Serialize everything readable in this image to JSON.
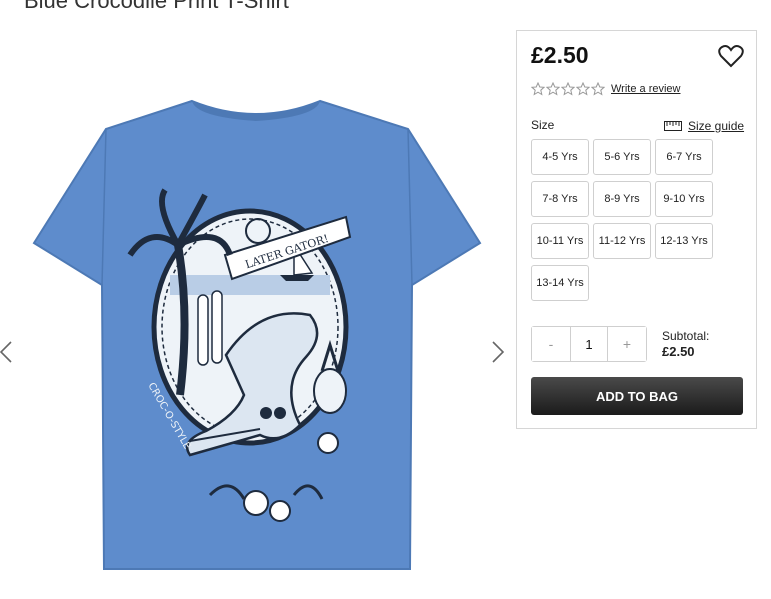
{
  "product": {
    "title": "Blue Crocodile Print T-Shirt",
    "price": "£2.50",
    "review_link": "Write a review",
    "rating_stars": 0,
    "rating_max": 5
  },
  "tshirt": {
    "print_banner": "LATER GATOR!",
    "print_side_text": "CROC-O-STYLE",
    "shirt_color": "#5e8ccc"
  },
  "size": {
    "label": "Size",
    "guide_label": "Size guide",
    "options": [
      "4-5 Yrs",
      "5-6 Yrs",
      "6-7 Yrs",
      "7-8 Yrs",
      "8-9 Yrs",
      "9-10 Yrs",
      "10-11 Yrs",
      "11-12 Yrs",
      "12-13 Yrs",
      "13-14 Yrs"
    ]
  },
  "quantity": {
    "minus": "-",
    "value": "1",
    "plus": "+"
  },
  "subtotal": {
    "label": "Subtotal:",
    "value": "£2.50"
  },
  "actions": {
    "add_to_bag": "ADD TO BAG"
  },
  "icons": {
    "prev": "chevron-left-icon",
    "next": "chevron-right-icon",
    "wishlist": "heart-icon",
    "size_guide": "ruler-icon"
  },
  "colors": {
    "button_dark": "#1b1b1b",
    "border": "#d6d6d6"
  }
}
